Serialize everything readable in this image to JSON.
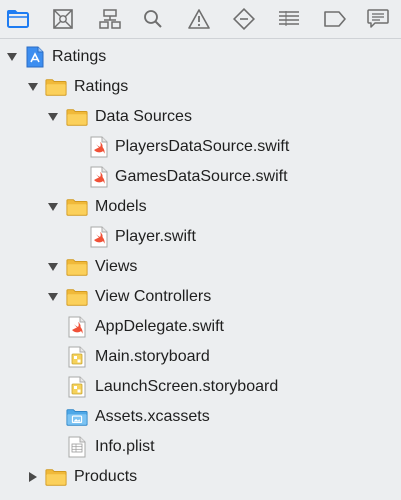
{
  "toolbar": {
    "icons": [
      "project-navigator-icon",
      "source-control-icon",
      "symbol-navigator-icon",
      "find-icon",
      "issue-icon",
      "test-icon",
      "debug-icon",
      "breakpoint-icon",
      "report-icon"
    ],
    "accent": "#1e7cf2"
  },
  "tree": [
    {
      "label": "Ratings",
      "icon": "project-icon",
      "expanded": true
    },
    {
      "label": "Ratings",
      "icon": "folder-icon",
      "expanded": true
    },
    {
      "label": "Data Sources",
      "icon": "folder-icon",
      "expanded": true
    },
    {
      "label": "PlayersDataSource.swift",
      "icon": "swift-file-icon"
    },
    {
      "label": "GamesDataSource.swift",
      "icon": "swift-file-icon"
    },
    {
      "label": "Models",
      "icon": "folder-icon",
      "expanded": true
    },
    {
      "label": "Player.swift",
      "icon": "swift-file-icon"
    },
    {
      "label": "Views",
      "icon": "folder-icon",
      "expanded": true
    },
    {
      "label": "View Controllers",
      "icon": "folder-icon",
      "expanded": true
    },
    {
      "label": "AppDelegate.swift",
      "icon": "swift-file-icon"
    },
    {
      "label": "Main.storyboard",
      "icon": "storyboard-file-icon"
    },
    {
      "label": "LaunchScreen.storyboard",
      "icon": "storyboard-file-icon"
    },
    {
      "label": "Assets.xcassets",
      "icon": "asset-catalog-icon"
    },
    {
      "label": "Info.plist",
      "icon": "plist-file-icon"
    },
    {
      "label": "Products",
      "icon": "folder-icon",
      "expanded": false
    }
  ]
}
